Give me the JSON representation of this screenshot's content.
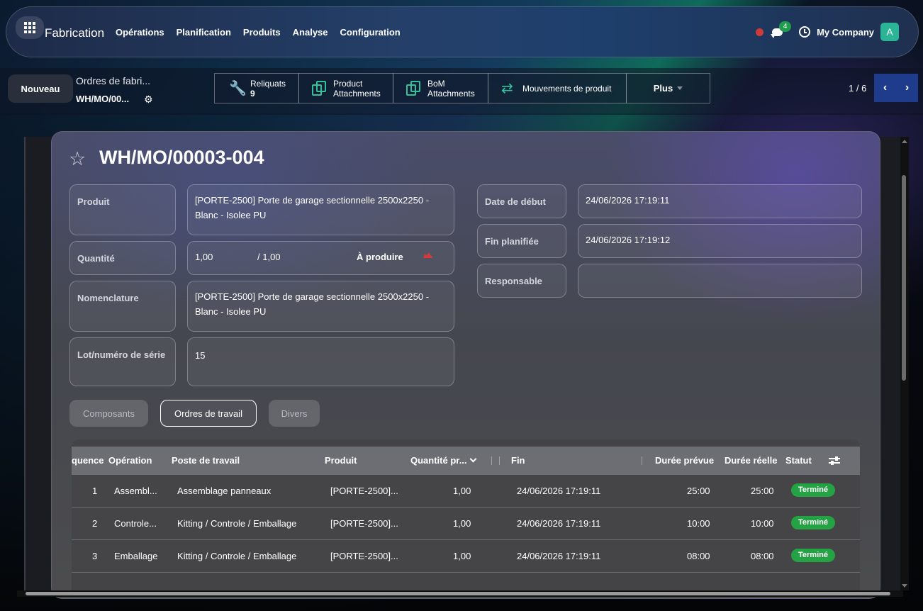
{
  "nav": {
    "app_name": "Fabrication",
    "menu": [
      "Opérations",
      "Planification",
      "Produits",
      "Analyse",
      "Configuration"
    ],
    "chat_count": "4",
    "company": "My Company",
    "avatar_initial": "A"
  },
  "control": {
    "new_label": "Nouveau",
    "breadcrumb_parent": "Ordres de fabri...",
    "breadcrumb_current": "WH/MO/00...",
    "smart_buttons": {
      "reliquats_label": "Reliquats",
      "reliquats_count": "9",
      "product_attach_1": "Product",
      "product_attach_2": "Attachments",
      "bom_attach_1": "BoM",
      "bom_attach_2": "Attachments",
      "moves_label": "Mouvements de produit",
      "more_label": "Plus"
    },
    "pager": "1 / 6"
  },
  "form": {
    "title": "WH/MO/00003-004",
    "labels": {
      "product": "Produit",
      "quantity": "Quantité",
      "bom": "Nomenclature",
      "lot": "Lot/numéro de série",
      "start": "Date de début",
      "end": "Fin planifiée",
      "responsible": "Responsable"
    },
    "values": {
      "product": "[PORTE-2500] Porte de garage sectionnelle 2500x2250 - Blanc - Isolee PU",
      "qty": "1,00",
      "qty_total": "/ 1,00",
      "qty_state": "À produire",
      "bom": "[PORTE-2500] Porte de garage sectionnelle 2500x2250 - Blanc - Isolee PU",
      "lot": "15",
      "start": "24/06/2026 17:19:11",
      "end": "24/06/2026 17:19:12",
      "responsible": ""
    }
  },
  "tabs": [
    "Composants",
    "Ordres de travail",
    "Divers"
  ],
  "table": {
    "headers": {
      "seq": "quence",
      "operation": "Opération",
      "workcenter": "Poste de travail",
      "product": "Produit",
      "qty": "Quantité pr...",
      "end": "Fin",
      "expected": "Durée prévue",
      "real": "Durée réelle",
      "status": "Statut"
    },
    "rows": [
      {
        "seq": "1",
        "operation": "Assembl...",
        "workcenter": "Assemblage panneaux",
        "product": "[PORTE-2500]...",
        "qty": "1,00",
        "end": "24/06/2026 17:19:11",
        "expected": "25:00",
        "real": "25:00",
        "status": "Terminé"
      },
      {
        "seq": "2",
        "operation": "Controle...",
        "workcenter": "Kitting / Controle / Emballage",
        "product": "[PORTE-2500]...",
        "qty": "1,00",
        "end": "24/06/2026 17:19:11",
        "expected": "10:00",
        "real": "10:00",
        "status": "Terminé"
      },
      {
        "seq": "3",
        "operation": "Emballage",
        "workcenter": "Kitting / Controle / Emballage",
        "product": "[PORTE-2500]...",
        "qty": "1,00",
        "end": "24/06/2026 17:19:11",
        "expected": "08:00",
        "real": "08:00",
        "status": "Terminé"
      }
    ]
  },
  "colors": {
    "accent_teal": "#35c09a",
    "status_green": "#25a244",
    "pager_blue": "#1f3b8c"
  }
}
